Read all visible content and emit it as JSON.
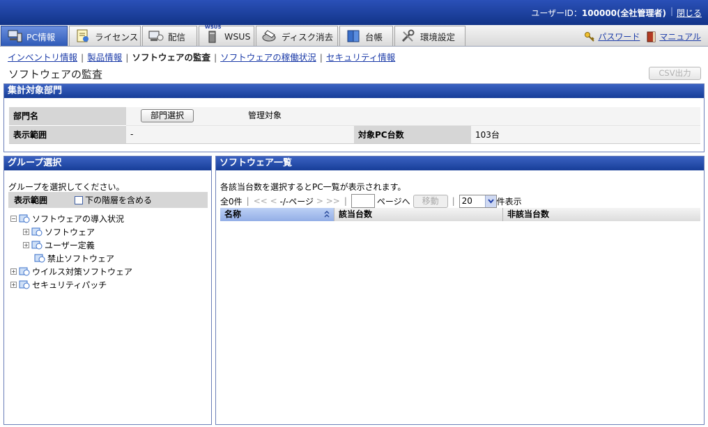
{
  "topbar": {
    "user_label": "ユーザーID：",
    "user_value": "100000(全社管理者)",
    "separator": "|",
    "close": "閉じる"
  },
  "tabs": [
    {
      "label": "PC情報",
      "icon": "pc-icon",
      "active": true
    },
    {
      "label": "ライセンス",
      "icon": "license-icon"
    },
    {
      "label": "配信",
      "icon": "distribution-icon"
    },
    {
      "label": "WSUS",
      "icon": "wsus-icon",
      "icon_text": "WSUS"
    },
    {
      "label": "ディスク消去",
      "icon": "disk-erase-icon"
    },
    {
      "label": "台帳",
      "icon": "ledger-icon"
    },
    {
      "label": "環境設定",
      "icon": "settings-icon"
    }
  ],
  "toplinks": {
    "password": "パスワード",
    "manual": "マニュアル"
  },
  "subnav": {
    "inventory": "インベントリ情報",
    "product": "製品情報",
    "current": "ソフトウェアの監査",
    "operation": "ソフトウェアの稼働状況",
    "security": "セキュリティ情報",
    "separator": "|"
  },
  "page": {
    "title": "ソフトウェアの監査",
    "csv_button": "CSV出力"
  },
  "aggregation": {
    "header": "集計対象部門",
    "dept_label": "部門名",
    "dept_button": "部門選択",
    "dept_value": "管理対象",
    "scope_label": "表示範囲",
    "scope_value": "-",
    "pc_count_label": "対象PC台数",
    "pc_count_value": "103台"
  },
  "group": {
    "header": "グループ選択",
    "instruction": "グループを選択してください。",
    "scope_label": "表示範囲",
    "include_lower": "下の階層を含める",
    "tree": [
      {
        "label": "ソフトウェアの導入状況",
        "expander": "⊟"
      },
      {
        "label": "ソフトウェア",
        "expander": "⊞"
      },
      {
        "label": "ユーザー定義",
        "expander": "⊞"
      },
      {
        "label": "禁止ソフトウェア",
        "expander": ""
      },
      {
        "label": "ウイルス対策ソフトウェア",
        "expander": "⊞"
      },
      {
        "label": "セキュリティパッチ",
        "expander": "⊞"
      }
    ]
  },
  "software": {
    "header": "ソフトウェア一覧",
    "instruction": "各該当台数を選択するとPC一覧が表示されます。",
    "pager": {
      "total": "全0件",
      "first": "<<",
      "prev": "<",
      "page_status": "-/-ページ",
      "next": ">",
      "last": ">>",
      "page_to": "ページへ",
      "move_button": "移動",
      "per_page": "20",
      "per_page_suffix": "件表示",
      "separator": "|"
    },
    "columns": [
      "名称",
      "該当台数",
      "非該当台数"
    ]
  },
  "colors": {
    "header_blue": "#1f47a8",
    "active_tab": "#3a64c2",
    "link": "#1b3ba8"
  }
}
